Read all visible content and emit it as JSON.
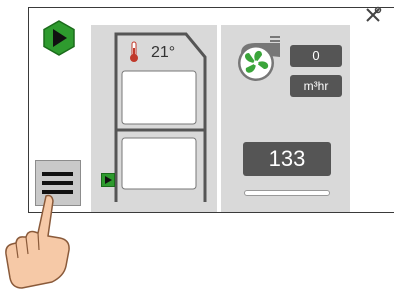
{
  "controls": {
    "play_icon": "play-icon",
    "settings_icon": "wrench-screwdriver-icon",
    "menu_icon": "hamburger-menu-icon"
  },
  "appliance": {
    "temperature": "21°",
    "thermometer_icon": "thermometer-icon",
    "indicator_icon": "small-play-icon"
  },
  "fan": {
    "icon": "fan-icon",
    "flow_value": "0",
    "flow_unit": "m³hr",
    "setpoint": "133",
    "slider_level": 0
  },
  "colors": {
    "accent_green": "#2e9b2e",
    "panel_gray": "#d9d9d9",
    "box_dark": "#555555"
  }
}
